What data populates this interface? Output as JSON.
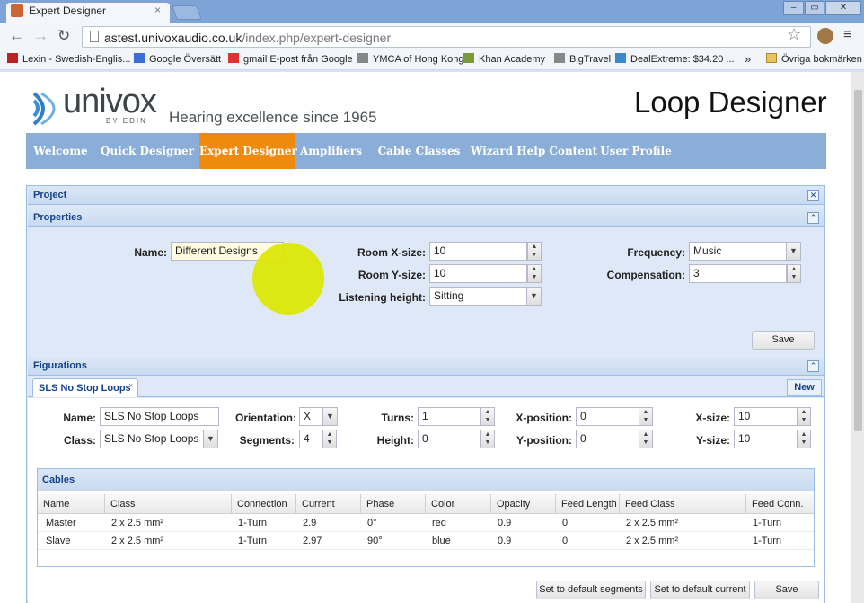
{
  "browser": {
    "tab_title": "Expert Designer",
    "tab_close": "×",
    "url_host": "astest.univoxaudio.co.uk",
    "url_path": "/index.php/expert-designer",
    "window_controls": [
      "–",
      "▭",
      "✕"
    ],
    "nav_icons": {
      "back": "←",
      "forward": "→",
      "reload": "↻",
      "star": "☆",
      "menu": "≡"
    },
    "bookmarks": [
      {
        "label": "Lexin - Swedish-Englis...",
        "icon": "lexin-icon",
        "color": "#b22"
      },
      {
        "label": "Google Översätt",
        "icon": "translate-icon",
        "color": "#3a6fd8"
      },
      {
        "label": "gmail E-post från Google",
        "icon": "gmail-icon",
        "color": "#d33"
      },
      {
        "label": "YMCA of Hong Kong",
        "icon": "page-icon",
        "color": "#888"
      },
      {
        "label": "Khan Academy",
        "icon": "khan-icon",
        "color": "#7a9a3a"
      },
      {
        "label": "BigTravel",
        "icon": "page-icon",
        "color": "#888"
      },
      {
        "label": "DealExtreme: $34.20 ...",
        "icon": "dx-icon",
        "color": "#3a8ad0"
      }
    ],
    "bookmarks_overflow": "»",
    "other_bookmarks": "Övriga bokmärken"
  },
  "header": {
    "logo_text": "univox",
    "logo_by": "BY EDIN",
    "tagline": "Hearing excellence since 1965",
    "title": "Loop Designer"
  },
  "nav": {
    "items": [
      {
        "label": "Welcome",
        "active": false
      },
      {
        "label": "Quick Designer",
        "active": false
      },
      {
        "label": "Expert Designer",
        "active": true
      },
      {
        "label": "Amplifiers",
        "active": false
      },
      {
        "label": "Cable Classes",
        "active": false
      },
      {
        "label": "Wizard Help Content",
        "active": false
      },
      {
        "label": "User Profile",
        "active": false
      }
    ]
  },
  "project": {
    "title": "Project",
    "close_icon": "✕",
    "properties": {
      "title": "Properties",
      "collapse_icon": "⌃",
      "name_label": "Name:",
      "name_value": "Different Designs",
      "room_x_label": "Room X-size:",
      "room_x_value": "10",
      "room_y_label": "Room Y-size:",
      "room_y_value": "10",
      "listening_label": "Listening height:",
      "listening_value": "Sitting",
      "frequency_label": "Frequency:",
      "frequency_value": "Music",
      "compensation_label": "Compensation:",
      "compensation_value": "3",
      "save_label": "Save"
    },
    "figurations": {
      "title": "Figurations",
      "collapse_icon": "⌃",
      "tab_label": "SLS No Stop Loops",
      "tab_close": "×",
      "new_label": "New",
      "name_label": "Name:",
      "name_value": "SLS No Stop Loops",
      "class_label": "Class:",
      "class_value": "SLS No Stop Loops",
      "orientation_label": "Orientation:",
      "orientation_value": "X",
      "segments_label": "Segments:",
      "segments_value": "4",
      "turns_label": "Turns:",
      "turns_value": "1",
      "height_label": "Height:",
      "height_value": "0",
      "xpos_label": "X-position:",
      "xpos_value": "0",
      "ypos_label": "Y-position:",
      "ypos_value": "0",
      "xsize_label": "X-size:",
      "xsize_value": "10",
      "ysize_label": "Y-size:",
      "ysize_value": "10"
    },
    "cables": {
      "title": "Cables",
      "columns": [
        "Name",
        "Class",
        "Connection",
        "Current",
        "Phase",
        "Color",
        "Opacity",
        "Feed Length",
        "Feed Class",
        "Feed Conn."
      ],
      "rows": [
        [
          "Master",
          "2 x 2.5 mm²",
          "1-Turn",
          "2.9",
          "0°",
          "red",
          "0.9",
          "0",
          "2 x 2.5 mm²",
          "1-Turn"
        ],
        [
          "Slave",
          "2 x 2.5 mm²",
          "1-Turn",
          "2.97",
          "90°",
          "blue",
          "0.9",
          "0",
          "2 x 2.5 mm²",
          "1-Turn"
        ]
      ]
    },
    "footer_buttons": [
      "Set to default segments",
      "Set to default current",
      "Save"
    ]
  },
  "colors": {
    "nav_bg": "#8aaed7",
    "nav_active": "#ee8a0e",
    "panel_header_text": "#15428b",
    "cursor_highlight": "#dce600"
  }
}
